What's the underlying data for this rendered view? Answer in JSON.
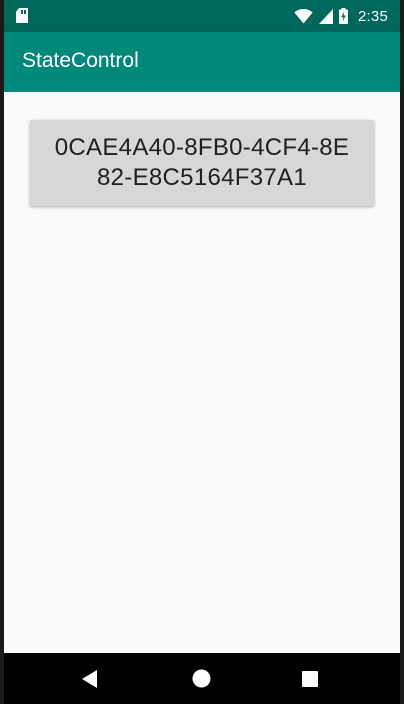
{
  "status_bar": {
    "time": "2:35",
    "icons": [
      "sd-card-icon",
      "wifi-icon",
      "signal-icon",
      "battery-charging-icon"
    ]
  },
  "app_bar": {
    "title": "StateControl"
  },
  "main": {
    "button_label": "0CAE4A40-8FB0-4CF4-8E82-E8C5164F37A1"
  },
  "nav_bar": {
    "buttons": [
      "back-icon",
      "home-icon",
      "recents-icon"
    ]
  },
  "colors": {
    "status_bar": "#00675b",
    "app_bar": "#00897b",
    "background": "#fafafa",
    "button": "#d6d7d7",
    "nav_bar": "#000000"
  }
}
